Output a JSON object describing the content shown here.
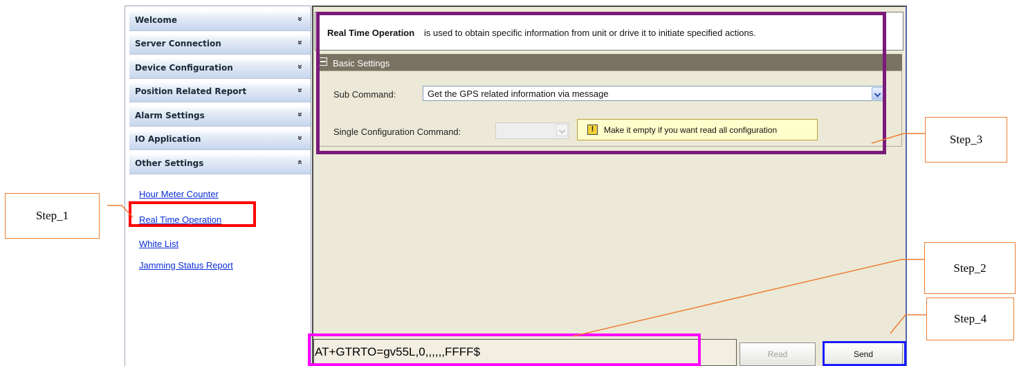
{
  "sidebar": {
    "sections": [
      {
        "label": "Welcome",
        "chevron": "double-chevron-down"
      },
      {
        "label": "Server Connection",
        "chevron": "double-chevron-down"
      },
      {
        "label": "Device Configuration",
        "chevron": "double-chevron-down"
      },
      {
        "label": "Position Related Report",
        "chevron": "double-chevron-down"
      },
      {
        "label": "Alarm Settings",
        "chevron": "double-chevron-down"
      },
      {
        "label": "IO Application",
        "chevron": "double-chevron-down"
      },
      {
        "label": "Other Settings",
        "chevron": "double-chevron-up",
        "expanded": true
      }
    ],
    "links": [
      {
        "label": "Hour Meter Counter"
      },
      {
        "label": "Real Time Operation"
      },
      {
        "label": "White List"
      },
      {
        "label": "Jamming Status Report"
      }
    ],
    "chevron_down": "»",
    "chevron_up": "«"
  },
  "main": {
    "description_title": "Real Time Operation",
    "description_text": "is used to obtain specific information from unit or drive it to initiate specified actions.",
    "section_title": "Basic Settings",
    "sub_command_label": "Sub Command:",
    "sub_command_value": "Get the GPS related information via message",
    "single_config_label": "Single Configuration Command:",
    "single_config_value": "",
    "hint_icon": "!",
    "hint_text": "Make it empty if you want read all configuration",
    "command_text": "AT+GTRTO=gv55L,0,,,,,,FFFF$",
    "read_button": "Read",
    "send_button": "Send",
    "read_disabled": true
  },
  "annotations": {
    "step1": "Step_1",
    "step2": "Step_2",
    "step3": "Step_3",
    "step4": "Step_4"
  },
  "colors": {
    "step1_highlight": "#ff0000",
    "step2_highlight": "#ff00ff",
    "step3_highlight": "#7a1a7a",
    "step4_highlight": "#1a1aff",
    "callout_border": "#ed7d31",
    "link": "#0b2dd8",
    "section_bar": "#7a7262"
  }
}
